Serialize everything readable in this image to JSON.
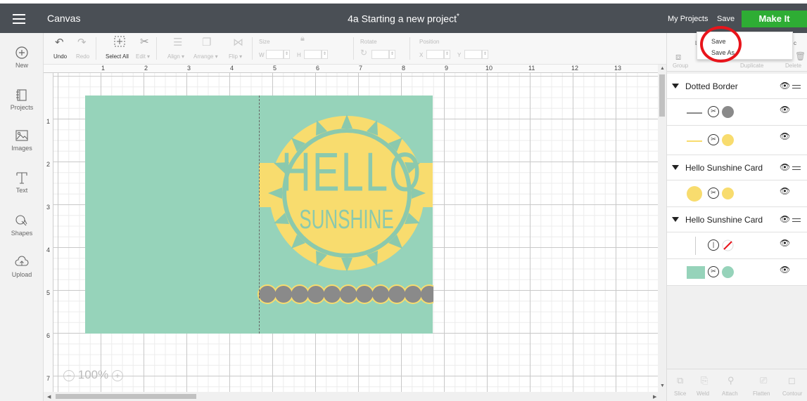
{
  "header": {
    "app_title": "Canvas",
    "doc_title": "4a Starting a new project",
    "unsaved_marker": "*",
    "my_projects": "My Projects",
    "save": "Save",
    "make_it": "Make It"
  },
  "sidebar": {
    "items": [
      {
        "label": "New",
        "icon": "plus-circle-icon"
      },
      {
        "label": "Projects",
        "icon": "projects-icon"
      },
      {
        "label": "Images",
        "icon": "images-icon"
      },
      {
        "label": "Text",
        "icon": "text-icon"
      },
      {
        "label": "Shapes",
        "icon": "shapes-icon"
      },
      {
        "label": "Upload",
        "icon": "upload-icon"
      }
    ]
  },
  "toolbar": {
    "undo": "Undo",
    "redo": "Redo",
    "select_all": "Select All",
    "edit": "Edit ▾",
    "align": "Align ▾",
    "arrange": "Arrange ▾",
    "flip": "Flip ▾",
    "size": "Size",
    "w": "W",
    "h": "H",
    "rotate": "Rotate",
    "position": "Position",
    "x": "X",
    "y": "Y"
  },
  "rulers": {
    "top": [
      "1",
      "2",
      "3",
      "4",
      "5",
      "6",
      "7",
      "8",
      "9",
      "10",
      "11",
      "12",
      "13"
    ],
    "left": [
      "1",
      "2",
      "3",
      "4",
      "5",
      "6",
      "7"
    ]
  },
  "design": {
    "hello": "HELLO",
    "sunshine": "SUNSHINE",
    "card_color": "#96d3ba",
    "yellow_color": "#f8dc6e",
    "gray_color": "#8a8a8a"
  },
  "zoom": {
    "minus": "−",
    "value": "100%",
    "plus": "+"
  },
  "layers_panel": {
    "header_visible": [
      "L",
      "c"
    ],
    "actions": [
      "Group",
      "Duplicate",
      "Delete"
    ],
    "rows": [
      {
        "type": "group",
        "name": "Dotted Border"
      },
      {
        "type": "layer",
        "line_color": "#8a8a8a",
        "fill_color": "#8a8a8a"
      },
      {
        "type": "layer",
        "line_color": "#f8dc6e",
        "fill_color": "#f8dc6e"
      },
      {
        "type": "group",
        "name": "Hello Sunshine Card"
      },
      {
        "type": "layer",
        "thumb_color": "#f8dc6e",
        "fill_color": "#f8dc6e"
      },
      {
        "type": "group",
        "name": "Hello Sunshine Card"
      },
      {
        "type": "layer",
        "icon": "no-fill-icon"
      },
      {
        "type": "layer",
        "thumb_color": "#96d3ba",
        "fill_color": "#96d3ba"
      }
    ],
    "footer": [
      "Slice",
      "Weld",
      "Attach",
      "Flatten",
      "Contour"
    ]
  },
  "save_dropdown": {
    "items": [
      "Save",
      "Save As"
    ]
  },
  "colors": {
    "topbar": "#4a4f55",
    "make_it": "#2ead34",
    "highlight": "#e8141b"
  }
}
